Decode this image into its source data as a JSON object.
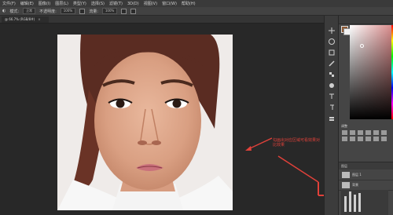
{
  "menubar": {
    "items": [
      "文件(F)",
      "编辑(E)",
      "图像(I)",
      "图层(L)",
      "类型(Y)",
      "选择(S)",
      "滤镜(T)",
      "3D(D)",
      "视图(V)",
      "窗口(W)",
      "帮助(H)"
    ]
  },
  "options": {
    "mode_label": "模式:",
    "mode_value": "正常",
    "opacity_label": "不透明度:",
    "opacity_value": "100%",
    "flow_label": "流量:",
    "flow_value": "100%"
  },
  "document": {
    "tab_label": "@ 66.7% (RGB/8#)",
    "close_symbol": "×"
  },
  "annotation": {
    "text": "勾画出对应区域可看效果对比效果",
    "color": "#e0413a"
  },
  "panels": {
    "adjustments_title": "调整",
    "layers_title": "图层",
    "layer_names": [
      "图层 1",
      "背景"
    ]
  },
  "colors": {
    "foreground": "#8e5a34",
    "background": "#f2f2f2"
  }
}
